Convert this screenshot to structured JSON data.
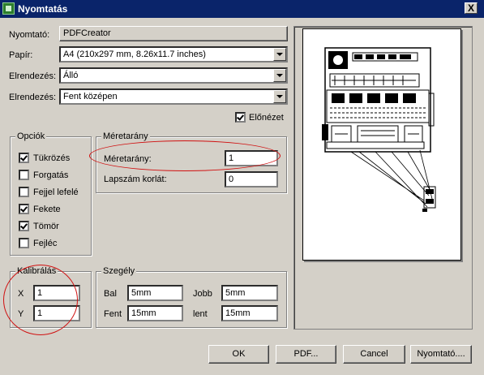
{
  "window": {
    "title": "Nyomtatás",
    "close_label": "X"
  },
  "printer": {
    "label": "Nyomtató:",
    "value": "PDFCreator"
  },
  "paper": {
    "label": "Papír:",
    "value": "A4 (210x297 mm, 8.26x11.7 inches)"
  },
  "layout1": {
    "label": "Elrendezés:",
    "value": "Álló"
  },
  "layout2": {
    "label": "Elrendezés:",
    "value": "Fent középen"
  },
  "preview_checkbox": {
    "label": "Előnézet",
    "checked": true
  },
  "options": {
    "title": "Opciók",
    "items": [
      {
        "label": "Tükrözés",
        "checked": true
      },
      {
        "label": "Forgatás",
        "checked": false
      },
      {
        "label": "Fejjel lefelé",
        "checked": false
      },
      {
        "label": "Fekete",
        "checked": true
      },
      {
        "label": "Tömör",
        "checked": true
      },
      {
        "label": "Fejléc",
        "checked": false
      }
    ]
  },
  "scale": {
    "title": "Méretarány",
    "ratio_label": "Méretarány:",
    "ratio_value": "1",
    "page_limit_label": "Lapszám korlát:",
    "page_limit_value": "0"
  },
  "calibration": {
    "title": "Kalibrálás",
    "x_label": "X",
    "x_value": "1",
    "y_label": "Y",
    "y_value": "1"
  },
  "margins": {
    "title": "Szegély",
    "left_label": "Bal",
    "left_value": "5mm",
    "right_label": "Jobb",
    "right_value": "5mm",
    "top_label": "Fent",
    "top_value": "15mm",
    "bottom_label": "lent",
    "bottom_value": "15mm"
  },
  "buttons": {
    "ok": "OK",
    "pdf": "PDF...",
    "cancel": "Cancel",
    "printer": "Nyomtató...."
  },
  "annotation_color": "#d01010"
}
